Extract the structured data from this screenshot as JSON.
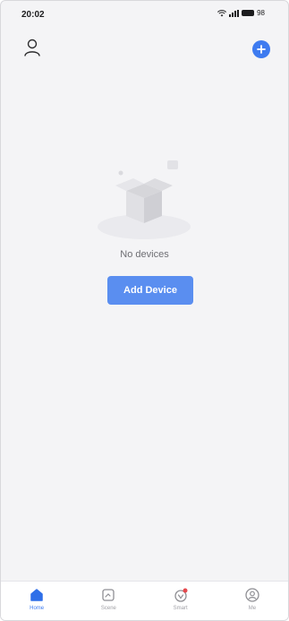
{
  "status_bar": {
    "time": "20:02",
    "battery": "98"
  },
  "header": {
    "user_icon": "user-icon",
    "add_icon": "plus-circle-icon"
  },
  "empty_state": {
    "message": "No devices",
    "button_label": "Add Device",
    "illustration": "empty-box-icon"
  },
  "nav": {
    "items": [
      {
        "label": "Home",
        "icon": "home-icon",
        "active": true
      },
      {
        "label": "Scene",
        "icon": "scene-icon",
        "active": false
      },
      {
        "label": "Smart",
        "icon": "smart-icon",
        "active": false
      },
      {
        "label": "Me",
        "icon": "me-icon",
        "active": false
      }
    ]
  },
  "colors": {
    "accent": "#3e7bf0",
    "button": "#5a8ef0",
    "background": "#f4f4f6",
    "badge": "#e5484d"
  }
}
